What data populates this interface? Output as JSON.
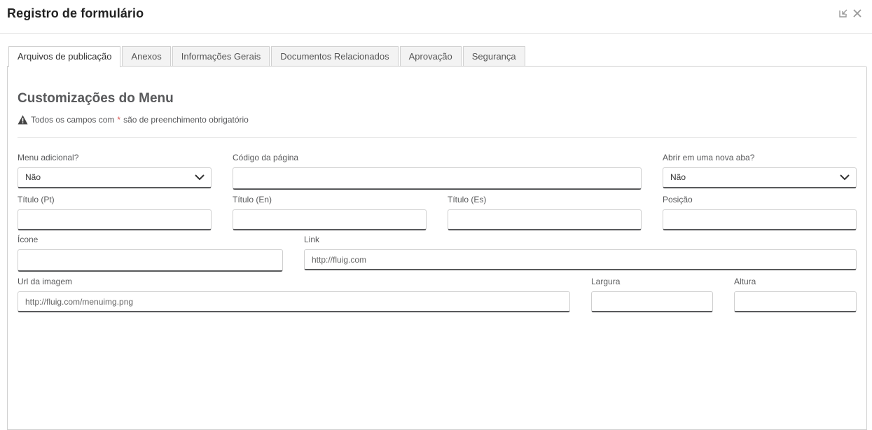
{
  "modal": {
    "title": "Registro de formulário"
  },
  "header_icons": [
    "minimize-icon",
    "close-icon"
  ],
  "tabs": [
    {
      "label": "Arquivos de publicação",
      "active": true
    },
    {
      "label": "Anexos",
      "active": false
    },
    {
      "label": "Informações Gerais",
      "active": false
    },
    {
      "label": "Documentos Relacionados",
      "active": false
    },
    {
      "label": "Aprovação",
      "active": false
    },
    {
      "label": "Segurança",
      "active": false
    }
  ],
  "section": {
    "title": "Customizações do Menu",
    "notice_before": "Todos os campos com",
    "notice_required_mark": "*",
    "notice_after": "são de preenchimento obrigatório"
  },
  "fields": {
    "menu_adicional": {
      "label": "Menu adicional?",
      "value": "Não"
    },
    "codigo_pagina": {
      "label": "Código da página",
      "value": "",
      "placeholder": ""
    },
    "abrir_nova_aba": {
      "label": "Abrir em uma nova aba?",
      "value": "Não"
    },
    "titulo_pt": {
      "label": "Título (Pt)",
      "value": "",
      "placeholder": ""
    },
    "titulo_en": {
      "label": "Título (En)",
      "value": "",
      "placeholder": ""
    },
    "titulo_es": {
      "label": "Título (Es)",
      "value": "",
      "placeholder": ""
    },
    "posicao": {
      "label": "Posição",
      "value": "",
      "placeholder": ""
    },
    "icone": {
      "label": "Ícone",
      "value": "",
      "placeholder": ""
    },
    "link": {
      "label": "Link",
      "value": "",
      "placeholder": "http://fluig.com"
    },
    "url_imagem": {
      "label": "Url da imagem",
      "value": "",
      "placeholder": "http://fluig.com/menuimg.png"
    },
    "largura": {
      "label": "Largura",
      "value": "",
      "placeholder": ""
    },
    "altura": {
      "label": "Altura",
      "value": "",
      "placeholder": ""
    }
  }
}
